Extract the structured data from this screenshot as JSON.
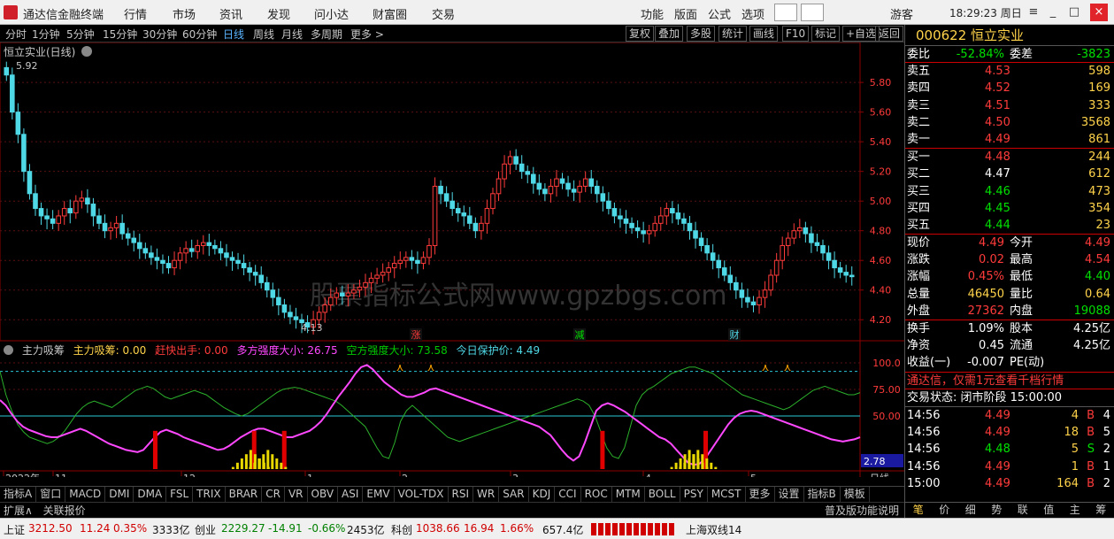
{
  "menubar": {
    "app_title": "通达信金融终端",
    "items": [
      "行情",
      "市场",
      "资讯",
      "发现",
      "问小达",
      "财富圈",
      "交易"
    ],
    "right_items": [
      "功能",
      "版面",
      "公式",
      "选项"
    ],
    "user": "游客",
    "clock": "18:29:23 周日"
  },
  "toolbar": {
    "left": [
      "分时",
      "1分钟",
      "5分钟",
      "15分钟",
      "30分钟",
      "60分钟",
      "日线",
      "周线",
      "月线",
      "多周期",
      "更多 >"
    ],
    "active": "日线",
    "right": [
      "复权",
      "叠加",
      "多股",
      "统计",
      "画线",
      "F10",
      "标记",
      "+自选",
      "返回"
    ]
  },
  "chart": {
    "title": "恒立实业(日线)",
    "max_label": "5.92",
    "min_label": "4.13",
    "price_ticks": [
      "5.80",
      "5.60",
      "5.40",
      "5.20",
      "5.00",
      "4.80",
      "4.60",
      "4.40",
      "4.20"
    ],
    "markers": [
      {
        "label": "涨",
        "color": "#ff3b3b"
      },
      {
        "label": "减",
        "color": "#00e000"
      },
      {
        "label": "财",
        "color": "#4fd8e6"
      }
    ],
    "watermark": "股票指标公式网www.gpzbgs.com"
  },
  "indicator": {
    "name": "主力吸筹",
    "labels": [
      {
        "text": "主力吸筹: 0.00",
        "color": "#ffd34a"
      },
      {
        "text": "赶快出手: 0.00",
        "color": "#ff3b3b"
      },
      {
        "text": "多方强度大小: 26.75",
        "color": "#ff48ff"
      },
      {
        "text": "空方强度大小: 73.58",
        "color": "#00c800"
      },
      {
        "text": "今日保护价: 4.49",
        "color": "#4fd8e6"
      }
    ],
    "ticks": [
      "100.0",
      "75.00",
      "50.00"
    ],
    "readout": "2.78"
  },
  "xaxis": {
    "labels": [
      "2022年",
      "11",
      "12",
      "1",
      "2",
      "3",
      "4",
      "5"
    ],
    "period": "日线"
  },
  "tabs": [
    "指标A",
    "窗口",
    "MACD",
    "DMI",
    "DMA",
    "FSL",
    "TRIX",
    "BRAR",
    "CR",
    "VR",
    "OBV",
    "ASI",
    "EMV",
    "VOL-TDX",
    "RSI",
    "WR",
    "SAR",
    "KDJ",
    "CCI",
    "ROC",
    "MTM",
    "BOLL",
    "PSY",
    "MCST",
    "更多",
    "设置",
    "指标B",
    "模板"
  ],
  "expand": [
    "扩展∧",
    "关联报价"
  ],
  "expand_right": "普及版功能说明",
  "quote": {
    "code": "000622",
    "name": "恒立实业",
    "weibi": {
      "label": "委比",
      "value": "-52.84%",
      "label2": "委差",
      "value2": "-3823"
    },
    "sells": [
      [
        "卖五",
        "4.53",
        "598"
      ],
      [
        "卖四",
        "4.52",
        "169"
      ],
      [
        "卖三",
        "4.51",
        "333"
      ],
      [
        "卖二",
        "4.50",
        "3568"
      ],
      [
        "卖一",
        "4.49",
        "861"
      ]
    ],
    "buys": [
      [
        "买一",
        "4.48",
        "244"
      ],
      [
        "买二",
        "4.47",
        "612"
      ],
      [
        "买三",
        "4.46",
        "473"
      ],
      [
        "买四",
        "4.45",
        "354"
      ],
      [
        "买五",
        "4.44",
        "23"
      ]
    ],
    "stats": [
      [
        "现价",
        "4.49",
        "今开",
        "4.49"
      ],
      [
        "涨跌",
        "0.02",
        "最高",
        "4.54"
      ],
      [
        "涨幅",
        "0.45%",
        "最低",
        "4.40"
      ],
      [
        "总量",
        "46450",
        "量比",
        "0.64"
      ],
      [
        "外盘",
        "27362",
        "内盘",
        "19088"
      ]
    ],
    "stats2": [
      [
        "换手",
        "1.09%",
        "股本",
        "4.25亿"
      ],
      [
        "净资",
        "0.45",
        "流通",
        "4.25亿"
      ],
      [
        "收益(一)",
        "-0.007",
        "PE(动)",
        ""
      ]
    ],
    "ad": "通达信，仅需1元查看千档行情",
    "trade_status": "交易状态: 闭市阶段 15:00:00",
    "ticks": [
      [
        "14:56",
        "4.49",
        "4",
        "B",
        "4"
      ],
      [
        "14:56",
        "4.49",
        "18",
        "B",
        "5"
      ],
      [
        "14:56",
        "4.48",
        "5",
        "S",
        "2"
      ],
      [
        "14:56",
        "4.49",
        "1",
        "B",
        "1"
      ],
      [
        "15:00",
        "4.49",
        "164",
        "B",
        "2"
      ]
    ],
    "tabs": [
      "笔",
      "价",
      "细",
      "势",
      "联",
      "值",
      "主",
      "筹"
    ]
  },
  "status": {
    "sh_label": "上证",
    "sh_val": "3212.50",
    "sh_chg": "11.24",
    "sh_pct": "0.35%",
    "sh_amt": "3333亿",
    "cy_label": "创业",
    "cy_val": "2229.27",
    "cy_chg": "-14.91",
    "cy_pct": "-0.66%",
    "cy_amt": "2453亿",
    "kc_label": "科创",
    "kc_val": "1038.66",
    "kc_chg": "16.94",
    "kc_pct": "1.66%",
    "kc_amt": "657.4亿",
    "line": "上海双线14"
  },
  "chart_data": {
    "type": "candlestick",
    "symbol": "000622 恒立实业",
    "period": "日线",
    "ylim": [
      4.1,
      5.95
    ],
    "closes": [
      5.85,
      5.6,
      5.45,
      5.2,
      5.05,
      4.95,
      4.9,
      4.88,
      4.85,
      4.9,
      4.95,
      4.92,
      5.0,
      5.02,
      4.98,
      4.9,
      4.85,
      4.8,
      4.82,
      4.85,
      4.78,
      4.75,
      4.72,
      4.68,
      4.65,
      4.62,
      4.6,
      4.58,
      4.55,
      4.6,
      4.65,
      4.68,
      4.66,
      4.7,
      4.72,
      4.7,
      4.68,
      4.65,
      4.62,
      4.6,
      4.58,
      4.55,
      4.52,
      4.5,
      4.45,
      4.4,
      4.35,
      4.3,
      4.25,
      4.22,
      4.2,
      4.18,
      4.15,
      4.2,
      4.25,
      4.3,
      4.35,
      4.38,
      4.36,
      4.38,
      4.4,
      4.42,
      4.45,
      4.48,
      4.5,
      4.52,
      4.55,
      4.58,
      4.6,
      4.62,
      4.6,
      4.58,
      4.62,
      4.7,
      5.1,
      5.05,
      5.0,
      4.95,
      4.92,
      4.9,
      4.85,
      4.8,
      4.85,
      4.95,
      5.05,
      5.15,
      5.25,
      5.3,
      5.25,
      5.2,
      5.18,
      5.12,
      5.08,
      5.05,
      5.1,
      5.15,
      5.12,
      5.08,
      5.06,
      5.1,
      5.15,
      5.1,
      5.05,
      5.0,
      4.95,
      4.9,
      4.88,
      4.85,
      4.82,
      4.8,
      4.78,
      4.8,
      4.85,
      4.9,
      4.95,
      4.92,
      4.88,
      4.85,
      4.8,
      4.75,
      4.7,
      4.65,
      4.6,
      4.55,
      4.5,
      4.45,
      4.4,
      4.35,
      4.32,
      4.3,
      4.35,
      4.4,
      4.5,
      4.6,
      4.7,
      4.75,
      4.8,
      4.82,
      4.78,
      4.72,
      4.7,
      4.65,
      4.6,
      4.55,
      4.52,
      4.5,
      4.49
    ],
    "osc": {
      "magenta": [
        65,
        60,
        52,
        45,
        40,
        37,
        35,
        33,
        31,
        30,
        30,
        32,
        34,
        36,
        38,
        36,
        33,
        30,
        27,
        24,
        22,
        20,
        18,
        17,
        16,
        18,
        24,
        30,
        35,
        37,
        35,
        33,
        30,
        28,
        26,
        24,
        22,
        20,
        18,
        19,
        22,
        26,
        30,
        33,
        36,
        38,
        38,
        36,
        34,
        32,
        30,
        30,
        32,
        34,
        36,
        40,
        45,
        52,
        60,
        68,
        75,
        82,
        90,
        96,
        98,
        94,
        88,
        82,
        78,
        74,
        70,
        68,
        68,
        70,
        72,
        75,
        76,
        74,
        72,
        70,
        68,
        66,
        64,
        62,
        60,
        58,
        56,
        54,
        52,
        50,
        48,
        46,
        44,
        42,
        40,
        36,
        32,
        25,
        18,
        12,
        8,
        12,
        25,
        40,
        55,
        60,
        62,
        60,
        57,
        54,
        50,
        46,
        42,
        38,
        34,
        30,
        28,
        24,
        18,
        12,
        6,
        4,
        5,
        10,
        18,
        26,
        34,
        42,
        48,
        52,
        54,
        55,
        54,
        52,
        50,
        48,
        46,
        44,
        42,
        40,
        38,
        36,
        34,
        32,
        30,
        28,
        27,
        26,
        27,
        28,
        30
      ],
      "green": [
        92,
        70,
        55,
        42,
        35,
        30,
        28,
        26,
        24,
        26,
        30,
        36,
        44,
        52,
        58,
        62,
        64,
        62,
        60,
        58,
        62,
        66,
        70,
        74,
        76,
        78,
        76,
        72,
        68,
        66,
        68,
        70,
        72,
        74,
        72,
        70,
        66,
        62,
        58,
        55,
        52,
        50,
        52,
        56,
        60,
        64,
        68,
        72,
        75,
        76,
        77,
        76,
        74,
        72,
        70,
        68,
        66,
        64,
        60,
        55,
        50,
        45,
        40,
        30,
        20,
        12,
        10,
        25,
        45,
        55,
        60,
        55,
        50,
        45,
        40,
        35,
        30,
        28,
        26,
        28,
        30,
        32,
        34,
        36,
        38,
        40,
        42,
        44,
        46,
        48,
        50,
        52,
        54,
        56,
        58,
        60,
        62,
        64,
        66,
        64,
        60,
        50,
        35,
        20,
        12,
        10,
        20,
        40,
        60,
        70,
        75,
        78,
        82,
        86,
        90,
        92,
        94,
        96,
        96,
        94,
        92,
        90,
        86,
        82,
        78,
        74,
        70,
        68,
        66,
        64,
        62,
        60,
        58,
        56,
        58,
        62,
        66,
        70,
        74,
        76,
        78,
        76,
        74,
        72,
        70,
        70,
        72
      ],
      "bars": [
        {
          "at": 0.18,
          "kind": "red"
        },
        {
          "at": 0.295,
          "kind": "red"
        },
        {
          "at": 0.33,
          "kind": "red"
        },
        {
          "at": 0.7,
          "kind": "red"
        },
        {
          "at": 0.82,
          "kind": "red"
        },
        {
          "at": 0.29,
          "kind": "yellow"
        },
        {
          "at": 0.31,
          "kind": "yellow"
        },
        {
          "at": 0.8,
          "kind": "yellow"
        },
        {
          "at": 0.81,
          "kind": "yellow"
        }
      ]
    }
  }
}
